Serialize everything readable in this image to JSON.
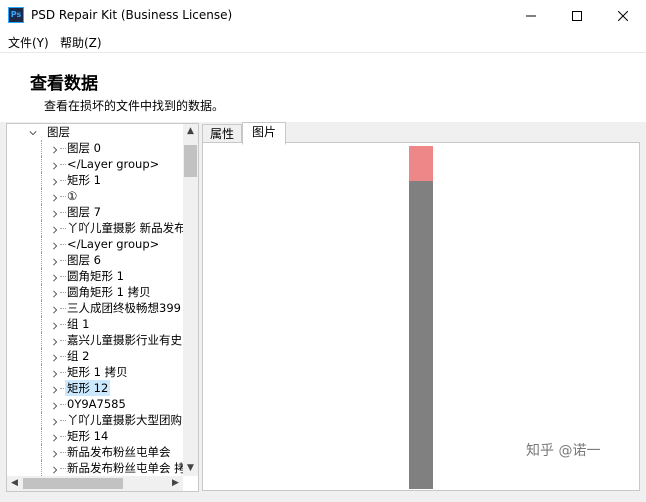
{
  "window": {
    "app_icon_text": "Ps",
    "title": "PSD Repair Kit (Business License)"
  },
  "menu": {
    "file": "文件(Y)",
    "help": "帮助(Z)"
  },
  "header": {
    "title": "查看数据",
    "subtitle": "查看在损坏的文件中找到的数据。"
  },
  "tree": {
    "root": "图层",
    "items": [
      {
        "label": "图层 0",
        "selected": false
      },
      {
        "label": "</Layer group>",
        "selected": false
      },
      {
        "label": "矩形 1",
        "selected": false
      },
      {
        "label": "①",
        "selected": false
      },
      {
        "label": "图层 7",
        "selected": false
      },
      {
        "label": "丫吖儿童摄影 新品发布",
        "selected": false
      },
      {
        "label": "</Layer group>",
        "selected": false
      },
      {
        "label": "图层 6",
        "selected": false
      },
      {
        "label": "圆角矩形 1",
        "selected": false
      },
      {
        "label": "圆角矩形 1 拷贝",
        "selected": false
      },
      {
        "label": "三人成团终极畅想399",
        "selected": false
      },
      {
        "label": "组 1",
        "selected": false
      },
      {
        "label": "嘉兴儿童摄影行业有史",
        "selected": false
      },
      {
        "label": "组 2",
        "selected": false
      },
      {
        "label": "矩形 1 拷贝",
        "selected": false
      },
      {
        "label": "矩形 12",
        "selected": true
      },
      {
        "label": "0Y9A7585",
        "selected": false
      },
      {
        "label": "丫吖儿童摄影大型团购",
        "selected": false
      },
      {
        "label": "矩形 14",
        "selected": false
      },
      {
        "label": "新品发布粉丝屯单会",
        "selected": false
      },
      {
        "label": "新品发布粉丝屯单会 拷",
        "selected": false
      }
    ]
  },
  "tabs": [
    {
      "label": "属性",
      "active": false
    },
    {
      "label": "图片",
      "active": true
    }
  ],
  "preview": {
    "bar_color": "#808080",
    "top_color": "#ee8888"
  },
  "watermark": "知乎 @诺一"
}
